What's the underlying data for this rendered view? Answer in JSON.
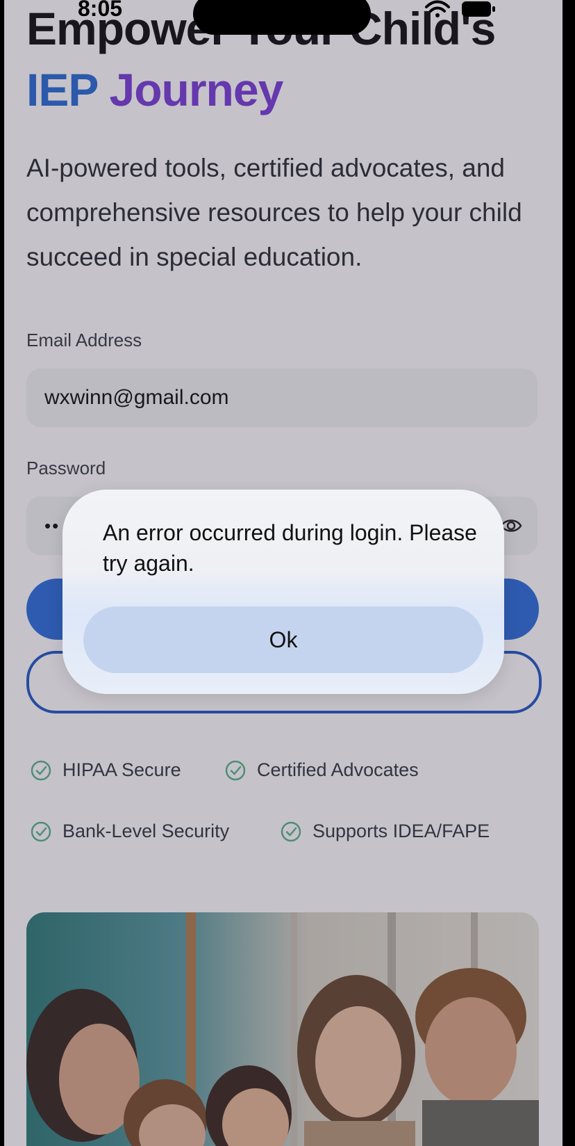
{
  "status_bar": {
    "time": "8:05"
  },
  "hero": {
    "title_line1": "Empower Your Child's",
    "title_iep": "IEP",
    "title_journey": "Journey",
    "subtitle": "AI-powered tools, certified advocates, and comprehensive resources to help your child succeed in special education."
  },
  "form": {
    "email_label": "Email Address",
    "email_value": "wxwinn@gmail.com",
    "password_label": "Password",
    "password_value": "••"
  },
  "badges": [
    "HIPAA Secure",
    "Certified Advocates",
    "Bank-Level Security",
    "Supports IDEA/FAPE"
  ],
  "colors": {
    "primary": "#2f6fdd",
    "accent_purple": "#7a3fd8",
    "check_green": "#5fb58b"
  },
  "alert": {
    "message": "An error occurred during login. Please try again.",
    "ok_label": "Ok"
  },
  "icons": {
    "eye": "eye-icon",
    "check": "check-circle-icon",
    "wifi": "wifi-icon",
    "battery": "battery-icon"
  }
}
